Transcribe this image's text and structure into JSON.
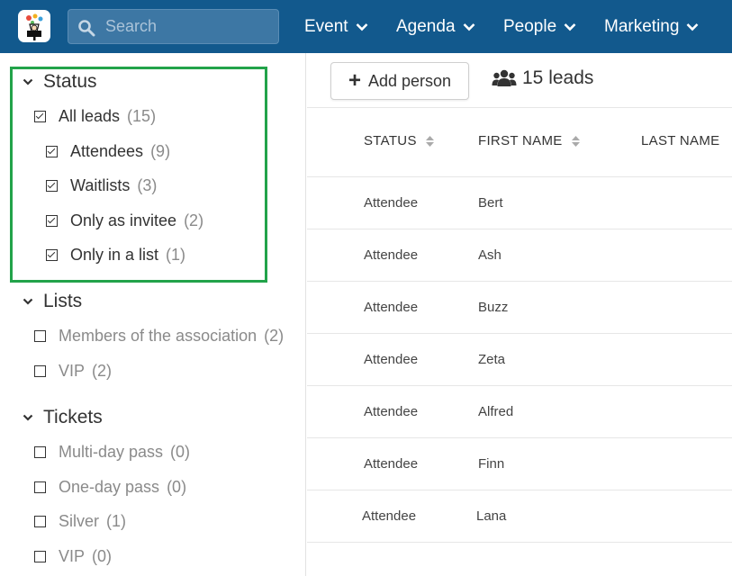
{
  "header": {
    "search_placeholder": "Search",
    "nav": [
      {
        "label": "Event"
      },
      {
        "label": "Agenda"
      },
      {
        "label": "People"
      },
      {
        "label": "Marketing"
      }
    ]
  },
  "sidebar": {
    "status": {
      "title": "Status",
      "items": [
        {
          "label": "All leads",
          "count": "(15)",
          "checked": true
        },
        {
          "label": "Attendees",
          "count": "(9)",
          "checked": true
        },
        {
          "label": "Waitlists",
          "count": "(3)",
          "checked": true
        },
        {
          "label": "Only as invitee",
          "count": "(2)",
          "checked": true
        },
        {
          "label": "Only in a list",
          "count": "(1)",
          "checked": true
        }
      ]
    },
    "lists": {
      "title": "Lists",
      "items": [
        {
          "label": "Members of the association",
          "count": "(2)",
          "checked": false
        },
        {
          "label": "VIP",
          "count": "(2)",
          "checked": false
        }
      ]
    },
    "tickets": {
      "title": "Tickets",
      "items": [
        {
          "label": "Multi-day pass",
          "count": "(0)",
          "checked": false
        },
        {
          "label": "One-day pass",
          "count": "(0)",
          "checked": false
        },
        {
          "label": "Silver",
          "count": "(1)",
          "checked": false
        },
        {
          "label": "VIP",
          "count": "(0)",
          "checked": false
        }
      ]
    }
  },
  "toolbar": {
    "add_label": "Add person",
    "leads_label": "15 leads"
  },
  "table": {
    "columns": [
      "STATUS",
      "FIRST NAME",
      "LAST NAME"
    ],
    "rows": [
      {
        "status": "Attendee",
        "first_name": "Bert"
      },
      {
        "status": "Attendee",
        "first_name": "Ash"
      },
      {
        "status": "Attendee",
        "first_name": "Buzz"
      },
      {
        "status": "Attendee",
        "first_name": "Zeta"
      },
      {
        "status": "Attendee",
        "first_name": "Alfred"
      },
      {
        "status": "Attendee",
        "first_name": "Finn"
      },
      {
        "status": "Attendee",
        "first_name": "Lana"
      }
    ]
  },
  "colors": {
    "header_bg": "#12598d",
    "highlight_border": "#22a34a"
  }
}
